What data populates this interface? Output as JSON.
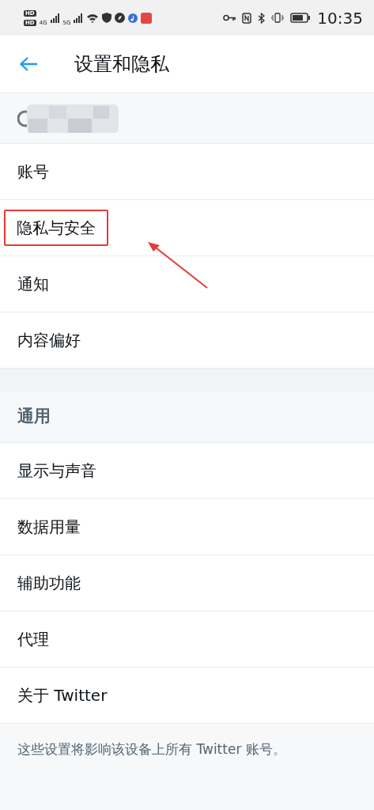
{
  "status_bar": {
    "sim_labels": [
      "HD",
      "HD"
    ],
    "network_labels": [
      "4G",
      "5G"
    ],
    "time": "10:35"
  },
  "header": {
    "title": "设置和隐私"
  },
  "sections": [
    {
      "items": [
        {
          "kind": "account"
        },
        {
          "kind": "item",
          "label": "账号",
          "highlighted": false
        },
        {
          "kind": "item",
          "label": "隐私与安全",
          "highlighted": true
        },
        {
          "kind": "item",
          "label": "通知",
          "highlighted": false
        },
        {
          "kind": "item",
          "label": "内容偏好",
          "highlighted": false
        }
      ]
    },
    {
      "title": "通用",
      "items": [
        {
          "kind": "item",
          "label": "显示与声音",
          "highlighted": false
        },
        {
          "kind": "item",
          "label": "数据用量",
          "highlighted": false
        },
        {
          "kind": "item",
          "label": "辅助功能",
          "highlighted": false
        },
        {
          "kind": "item",
          "label": "代理",
          "highlighted": false
        },
        {
          "kind": "item",
          "label": "关于 Twitter",
          "highlighted": false
        }
      ]
    }
  ],
  "footer": "这些设置将影响该设备上所有 Twitter 账号。"
}
